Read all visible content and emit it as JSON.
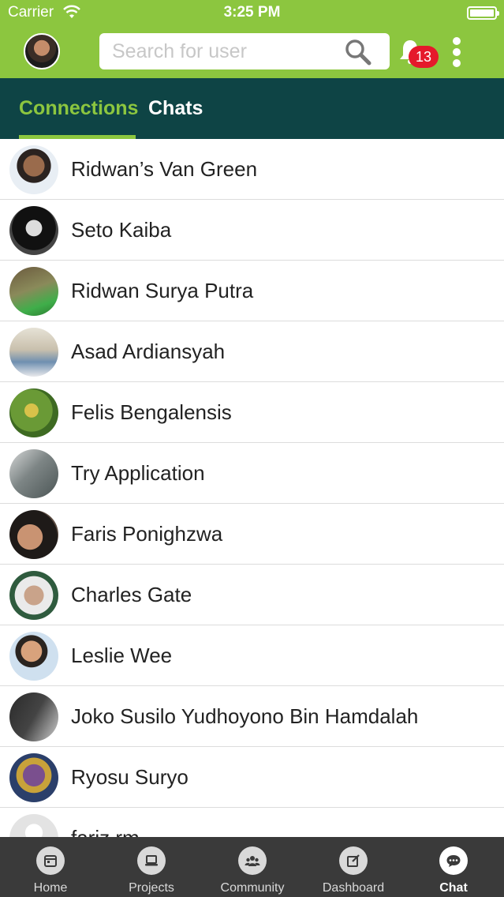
{
  "status": {
    "carrier": "Carrier",
    "time": "3:25 PM"
  },
  "header": {
    "search_placeholder": "Search for user",
    "notification_count": "13"
  },
  "tabs": [
    {
      "label": "Connections",
      "active": true
    },
    {
      "label": "Chats",
      "active": false
    }
  ],
  "contacts": [
    {
      "name": "Ridwan’s Van Green"
    },
    {
      "name": "Seto Kaiba"
    },
    {
      "name": "Ridwan Surya Putra"
    },
    {
      "name": "Asad Ardiansyah"
    },
    {
      "name": "Felis Bengalensis"
    },
    {
      "name": "Try Application"
    },
    {
      "name": "Faris Ponighzwa"
    },
    {
      "name": "Charles Gate"
    },
    {
      "name": "Leslie Wee"
    },
    {
      "name": "Joko Susilo Yudhoyono Bin Hamdalah"
    },
    {
      "name": "Ryosu Suryo"
    },
    {
      "name": "fariz rm"
    }
  ],
  "nav": [
    {
      "label": "Home",
      "icon": "calendar-icon"
    },
    {
      "label": "Projects",
      "icon": "laptop-icon"
    },
    {
      "label": "Community",
      "icon": "group-icon"
    },
    {
      "label": "Dashboard",
      "icon": "edit-icon"
    },
    {
      "label": "Chat",
      "icon": "chat-bubble-icon",
      "active": true
    }
  ],
  "colors": {
    "header_green": "#8cc63f",
    "tab_bar": "#0e4445",
    "badge_red": "#e5192b",
    "nav_bg": "#3a3a3a"
  }
}
